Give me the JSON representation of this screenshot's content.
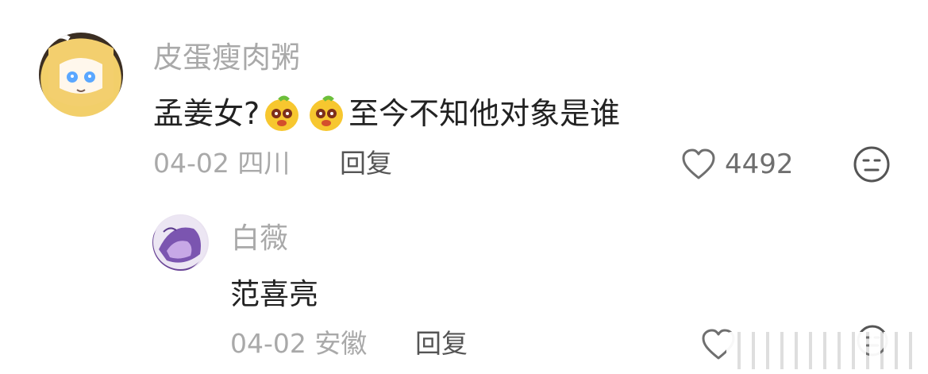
{
  "comments": [
    {
      "username": "皮蛋瘦肉粥",
      "text_prefix": "孟姜女?",
      "text_suffix": "至今不知他对象是谁",
      "emoji_name": "lemon-cry-emoji",
      "meta": "04-02 四川",
      "reply_label": "回复",
      "like_count": "4492",
      "icons": {
        "like": "heart-outline-icon",
        "react": "meh-face-icon"
      }
    }
  ],
  "reply": {
    "username": "白薇",
    "text": "范喜亮",
    "meta": "04-02 安徽",
    "reply_label": "回复",
    "icons": {
      "like": "heart-outline-icon",
      "react": "meh-face-icon"
    }
  },
  "colors": {
    "muted": "#a9a9a9",
    "text": "#222222",
    "icon": "#555555",
    "emoji": "#f7c72f"
  }
}
